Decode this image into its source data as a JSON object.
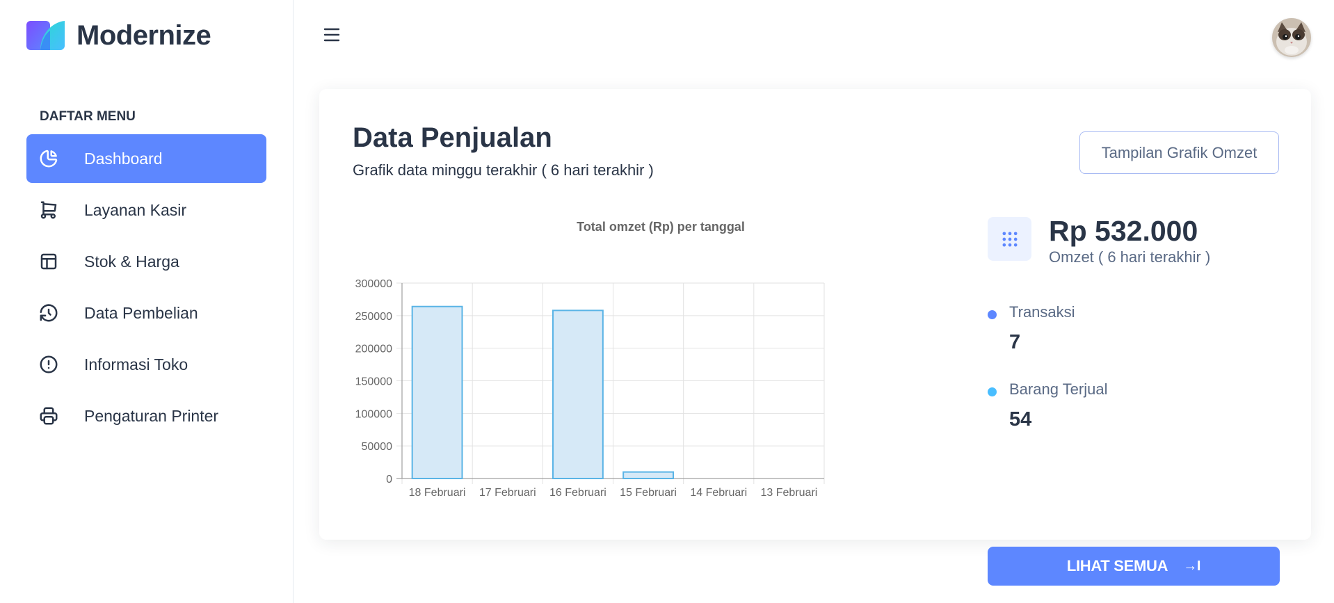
{
  "brand": {
    "name": "Modernize"
  },
  "sidebar": {
    "caption": "DAFTAR MENU",
    "items": [
      {
        "label": "Dashboard",
        "icon": "pie-chart-icon",
        "active": true
      },
      {
        "label": "Layanan Kasir",
        "icon": "shopping-cart-icon"
      },
      {
        "label": "Stok & Harga",
        "icon": "table-layout-icon"
      },
      {
        "label": "Data Pembelian",
        "icon": "history-icon"
      },
      {
        "label": "Informasi Toko",
        "icon": "info-circle-icon"
      },
      {
        "label": "Pengaturan Printer",
        "icon": "printer-icon"
      }
    ]
  },
  "header": {
    "menu_icon": "hamburger-icon",
    "avatar": "user-avatar"
  },
  "card": {
    "title": "Data Penjualan",
    "subtitle": "Grafik data minggu terakhir ( 6 hari terakhir )",
    "toggle_label": "Tampilan Grafik Omzet"
  },
  "stats": {
    "omzet_value": "Rp 532.000",
    "omzet_label": "Omzet ( 6 hari terakhir )",
    "transaksi_label": "Transaksi",
    "transaksi_value": "7",
    "barang_label": "Barang Terjual",
    "barang_value": "54",
    "see_all_label": "LIHAT SEMUA",
    "see_all_arrow": "→I"
  },
  "colors": {
    "accent": "#5d87ff",
    "secondary": "#49beff",
    "bar_fill": "#d6e9f7",
    "bar_stroke": "#5ab4e6"
  },
  "chart_data": {
    "type": "bar",
    "title": "Total omzet (Rp) per tanggal",
    "categories": [
      "18 Februari",
      "17 Februari",
      "16 Februari",
      "15 Februari",
      "14 Februari",
      "13 Februari"
    ],
    "values": [
      264000,
      0,
      258000,
      10000,
      0,
      0
    ],
    "yticks": [
      "300000",
      "250000",
      "200000",
      "150000",
      "100000",
      "50000",
      "0"
    ],
    "ylim": [
      0,
      300000
    ],
    "grid": true
  }
}
